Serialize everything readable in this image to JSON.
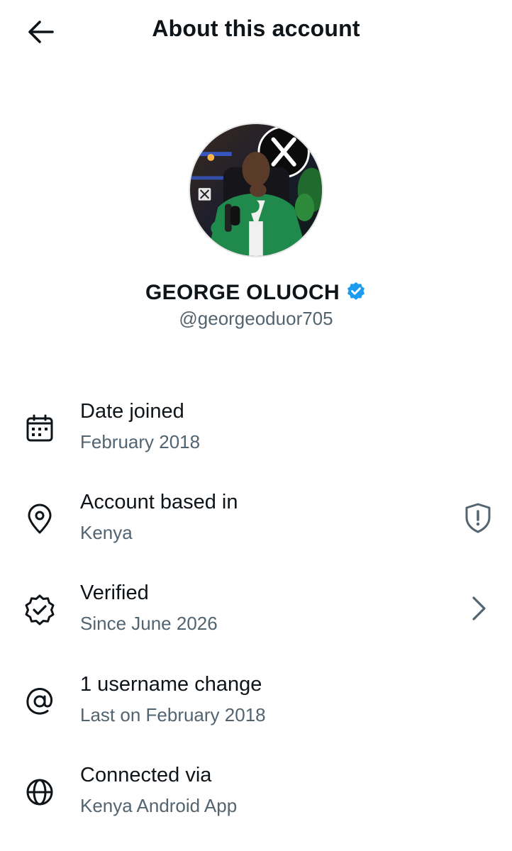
{
  "header": {
    "title": "About this account"
  },
  "profile": {
    "name": "GEORGE OLUOCH",
    "handle": "@georgeoduor705",
    "verified_color": "#1d9bf0"
  },
  "rows": [
    {
      "label": "Date joined",
      "sub": "February 2018",
      "icon": "calendar-icon"
    },
    {
      "label": "Account based in",
      "sub": "Kenya",
      "icon": "location-pin-icon",
      "right_icon": "shield-alert-icon"
    },
    {
      "label": "Verified",
      "sub": "Since June 2026",
      "icon": "verified-badge-icon",
      "right_icon": "chevron-right-icon"
    },
    {
      "label": "1 username change",
      "sub": "Last on February 2018",
      "icon": "at-sign-icon"
    },
    {
      "label": "Connected via",
      "sub": "Kenya Android App",
      "icon": "globe-icon"
    }
  ],
  "colors": {
    "text": "#0f1419",
    "secondary": "#536471",
    "accent": "#1d9bf0"
  }
}
